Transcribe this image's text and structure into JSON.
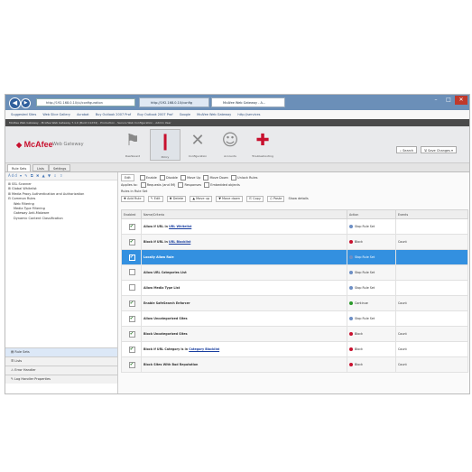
{
  "browser": {
    "url": "http://192.168.0.10/ui/configuration",
    "tabs": [
      "http://192.168.0.10/config",
      "McAfee Web Gateway - A..."
    ],
    "favorites": [
      "Suggested Sites",
      "Web Slice Gallery",
      "Acrobat",
      "Buy Outlook 2007 Prof",
      "Buy Outlook 2007 Prof",
      "Google",
      "McAfee Web Gateway",
      "http://services"
    ],
    "info_text": "McAfee Web Gateway - McAfee Web Gateway 7.1.0 (Build 11234) - Production - Secure Web Configuration - Admin User"
  },
  "app": {
    "logo": "McAfee",
    "logo_sub": "Web Gateway",
    "nav": [
      {
        "label": "Dashboard",
        "icon": "pin-icon"
      },
      {
        "label": "Policy",
        "icon": "policy-icon"
      },
      {
        "label": "Configuration",
        "icon": "tools-icon"
      },
      {
        "label": "Accounts",
        "icon": "users-icon"
      },
      {
        "label": "Troubleshooting",
        "icon": "plus-icon"
      }
    ],
    "search_label": "Search",
    "save_label": "Save Changes"
  },
  "subtabs": [
    "Rule Sets",
    "Lists",
    "Settings"
  ],
  "left": {
    "toolbar": "Add ▾ ✎ ⧉ ✖ ▲ ▼ ⇩ ⇧",
    "tree": [
      "SSL Scanner",
      "Global Whitelist",
      "Media Proxy Authentication and Authorization",
      "Common Rules",
      "Web Filtering",
      "Media Type Filtering",
      "Gateway Anti-Malware",
      "Dynamic Content Classification"
    ],
    "selected_index": 4,
    "bottom_buttons": [
      "Rule Sets",
      "Lists",
      "Error Handler",
      "Log Handler Properties"
    ]
  },
  "main": {
    "toolbar": {
      "buttons": [
        "Edit",
        "Enable",
        "Disable",
        "Move Up",
        "Move Down",
        "Unlock Rules"
      ],
      "line1_label": "Applies to:",
      "line1_opts": [
        "Requests (and IM)",
        "Responses",
        "Embedded objects"
      ],
      "line2": "Rules in Rule Set",
      "actions": [
        "Add Rule",
        "Edit",
        "Delete",
        "Move up",
        "Move down",
        "Copy",
        "Paste",
        "Show details"
      ]
    },
    "columns": [
      "Enabled",
      "Name/Criteria",
      "Action",
      "Events"
    ],
    "rows": [
      {
        "enabled": true,
        "name": "Allow if URL in ",
        "link": "URL Whitelist",
        "action": "Stop Rule Set",
        "events": "",
        "selected": false
      },
      {
        "enabled": true,
        "name": "Block if URL in ",
        "link": "URL Blacklist",
        "action": "Block",
        "events": "Count",
        "selected": false
      },
      {
        "enabled": true,
        "name": "Locally Allow Rule",
        "link": "",
        "action": "Stop Rule Set",
        "events": "",
        "selected": true
      },
      {
        "enabled": false,
        "name": "Allow URL Categories List",
        "link": "",
        "action": "Stop Rule Set",
        "events": "",
        "selected": false
      },
      {
        "enabled": false,
        "name": "Allow Media Type List",
        "link": "",
        "action": "Stop Rule Set",
        "events": "",
        "selected": false
      },
      {
        "enabled": true,
        "name": "Enable SafeSearch Enforcer",
        "link": "",
        "action": "Continue",
        "events": "Count",
        "selected": false
      },
      {
        "enabled": true,
        "name": "Allow Uncategorized Sites",
        "link": "",
        "action": "Stop Rule Set",
        "events": "",
        "selected": false
      },
      {
        "enabled": true,
        "name": "Block Uncategorized Sites",
        "link": "",
        "action": "Block",
        "events": "Count",
        "selected": false
      },
      {
        "enabled": true,
        "name": "Block if URL Category is in ",
        "link": "Category Blocklist",
        "action": "Block",
        "events": "Count",
        "selected": false
      },
      {
        "enabled": true,
        "name": "Block Sites With Bad Reputation",
        "link": "",
        "action": "Block",
        "events": "Count",
        "selected": false
      }
    ]
  },
  "colors": {
    "titlebar": "#6b8fb8",
    "selected_row": "#3390e0",
    "brand_red": "#c8102e",
    "block": "#c8102e",
    "continue": "#2a9a2a",
    "stop": "#6c8ec4"
  }
}
